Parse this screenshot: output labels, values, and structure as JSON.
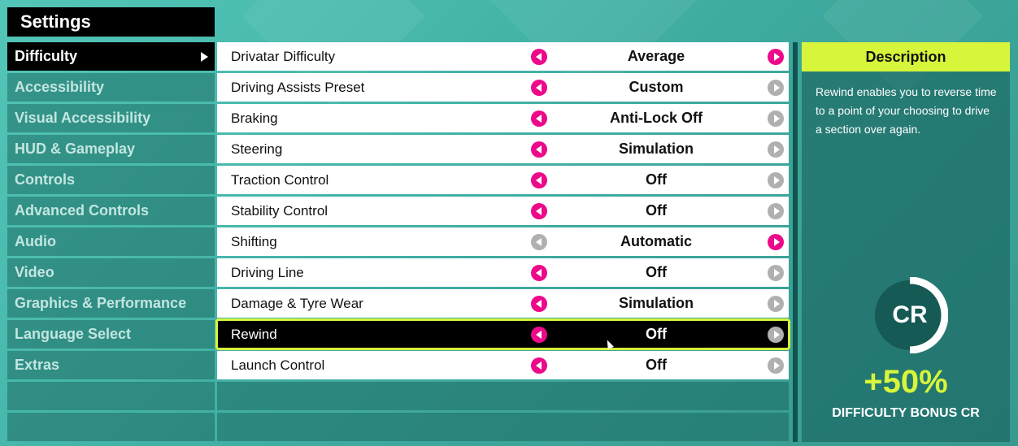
{
  "title": "Settings",
  "sidebar": {
    "items": [
      {
        "label": "Difficulty",
        "active": true
      },
      {
        "label": "Accessibility"
      },
      {
        "label": "Visual Accessibility"
      },
      {
        "label": "HUD & Gameplay"
      },
      {
        "label": "Controls"
      },
      {
        "label": "Advanced Controls"
      },
      {
        "label": "Audio"
      },
      {
        "label": "Video"
      },
      {
        "label": "Graphics & Performance"
      },
      {
        "label": "Language Select"
      },
      {
        "label": "Extras"
      }
    ]
  },
  "settings": {
    "rows": [
      {
        "label": "Drivatar Difficulty",
        "value": "Average",
        "left_enabled": true,
        "right_enabled": true
      },
      {
        "label": "Driving Assists Preset",
        "value": "Custom",
        "left_enabled": true,
        "right_enabled": false
      },
      {
        "label": "Braking",
        "value": "Anti-Lock Off",
        "left_enabled": true,
        "right_enabled": false
      },
      {
        "label": "Steering",
        "value": "Simulation",
        "left_enabled": true,
        "right_enabled": false
      },
      {
        "label": "Traction Control",
        "value": "Off",
        "left_enabled": true,
        "right_enabled": false
      },
      {
        "label": "Stability Control",
        "value": "Off",
        "left_enabled": true,
        "right_enabled": false
      },
      {
        "label": "Shifting",
        "value": "Automatic",
        "left_enabled": false,
        "right_enabled": true
      },
      {
        "label": "Driving Line",
        "value": "Off",
        "left_enabled": true,
        "right_enabled": false
      },
      {
        "label": "Damage & Tyre Wear",
        "value": "Simulation",
        "left_enabled": true,
        "right_enabled": false
      },
      {
        "label": "Rewind",
        "value": "Off",
        "left_enabled": true,
        "right_enabled": false,
        "selected": true
      },
      {
        "label": "Launch Control",
        "value": "Off",
        "left_enabled": true,
        "right_enabled": false
      }
    ]
  },
  "description": {
    "header": "Description",
    "text": "Rewind enables you to reverse time to a point of your choosing to drive a section over again.",
    "cr_badge": "CR",
    "bonus_value": "+50%",
    "bonus_label": "DIFFICULTY BONUS CR"
  },
  "colors": {
    "accent_pink": "#ec0a8a",
    "accent_lime": "#d7f53a",
    "disabled_grey": "#b0b0b0"
  }
}
